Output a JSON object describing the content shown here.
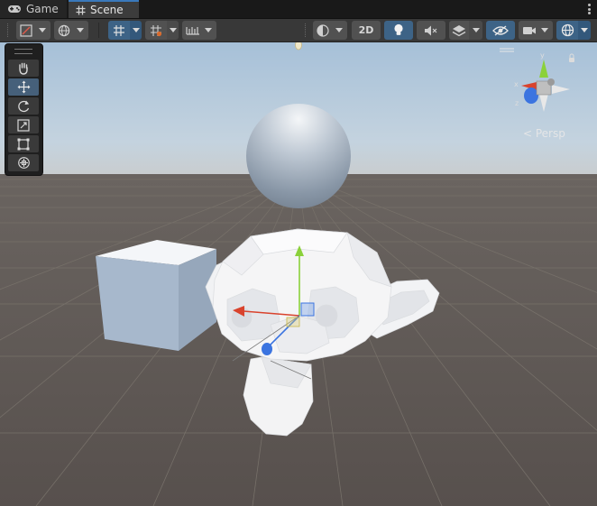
{
  "tabs": [
    {
      "label": "Game",
      "icon": "gamepad-icon",
      "active": false
    },
    {
      "label": "Scene",
      "icon": "grid-hash-icon",
      "active": true
    }
  ],
  "toolbar": {
    "view_2d_label": "2D",
    "items": [
      "draw-mode",
      "render-mode",
      "grid-snapping",
      "increment-snap",
      "snap-settings",
      "shading-mode",
      "2d-toggle",
      "lighting",
      "audio",
      "effects",
      "visibility",
      "camera",
      "gizmos"
    ]
  },
  "tools": [
    "View Tool",
    "Move Tool",
    "Rotate Tool",
    "Scale Tool",
    "Rect Tool",
    "Transform Tool"
  ],
  "active_tool": "Move Tool",
  "scene_gizmo": {
    "projection_label": "< Persp",
    "axes": [
      "x",
      "y",
      "z"
    ]
  },
  "colors": {
    "accent": "#3a79bb",
    "axis_x": "#d9432d",
    "axis_y": "#8bd13a",
    "axis_z": "#3b74e0",
    "sky": "#a9c3dc",
    "ground": "#5c5652"
  }
}
